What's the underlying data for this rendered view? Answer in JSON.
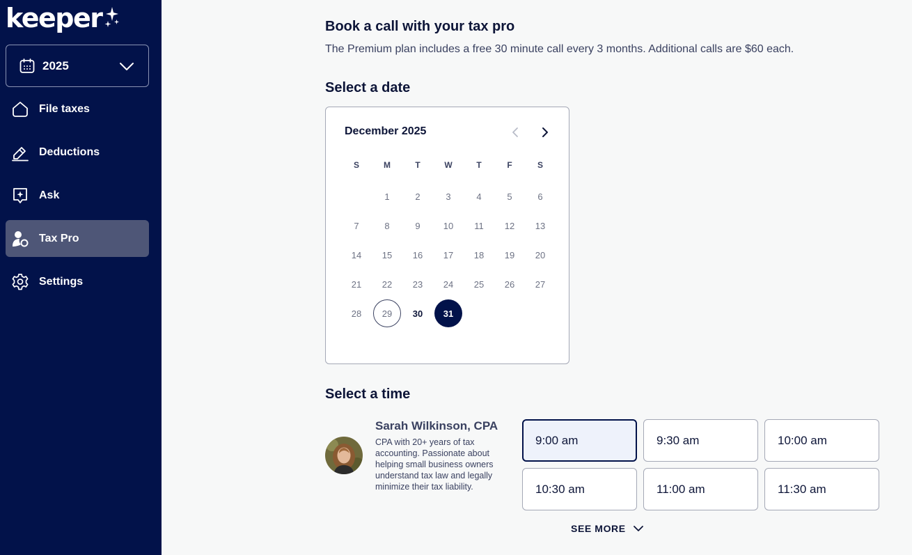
{
  "sidebar": {
    "logo_text": "keeper",
    "year_selector": {
      "value": "2025"
    },
    "items": [
      {
        "label": "File taxes",
        "icon": "home-icon",
        "active": false
      },
      {
        "label": "Deductions",
        "icon": "pencil-icon",
        "active": false
      },
      {
        "label": "Ask",
        "icon": "chat-sparkle-icon",
        "active": false
      },
      {
        "label": "Tax Pro",
        "icon": "tax-pro-icon",
        "active": true
      },
      {
        "label": "Settings",
        "icon": "gear-icon",
        "active": false
      }
    ]
  },
  "main": {
    "title": "Book a call with your tax pro",
    "subtitle": "The Premium plan includes a free 30 minute call every 3 months. Additional calls are $60 each.",
    "date_heading": "Select a date",
    "time_heading": "Select a time",
    "calendar": {
      "month_label": "December 2025",
      "weekdays": [
        "S",
        "M",
        "T",
        "W",
        "T",
        "F",
        "S"
      ],
      "weeks": [
        [
          "",
          "1",
          "2",
          "3",
          "4",
          "5",
          "6"
        ],
        [
          "7",
          "8",
          "9",
          "10",
          "11",
          "12",
          "13"
        ],
        [
          "14",
          "15",
          "16",
          "17",
          "18",
          "19",
          "20"
        ],
        [
          "21",
          "22",
          "23",
          "24",
          "25",
          "26",
          "27"
        ],
        [
          "28",
          "29",
          "30",
          "31",
          "",
          "",
          ""
        ]
      ],
      "today": "29",
      "available": [
        "30",
        "31"
      ],
      "selected": "31"
    },
    "pro": {
      "name": "Sarah Wilkinson, CPA",
      "bio": "CPA with 20+ years of tax accounting. Passionate about helping small business owners understand tax law and legally minimize their tax liability."
    },
    "time_slots": [
      {
        "label": "9:00 am",
        "selected": true
      },
      {
        "label": "9:30 am",
        "selected": false
      },
      {
        "label": "10:00 am",
        "selected": false
      },
      {
        "label": "10:30 am",
        "selected": false
      },
      {
        "label": "11:00 am",
        "selected": false
      },
      {
        "label": "11:30 am",
        "selected": false
      }
    ],
    "see_more_label": "SEE MORE"
  },
  "colors": {
    "sidebar_bg": "#02124a",
    "active_nav_bg": "#4e5677",
    "accent": "#02124a",
    "page_bg": "#f7f8f8"
  }
}
